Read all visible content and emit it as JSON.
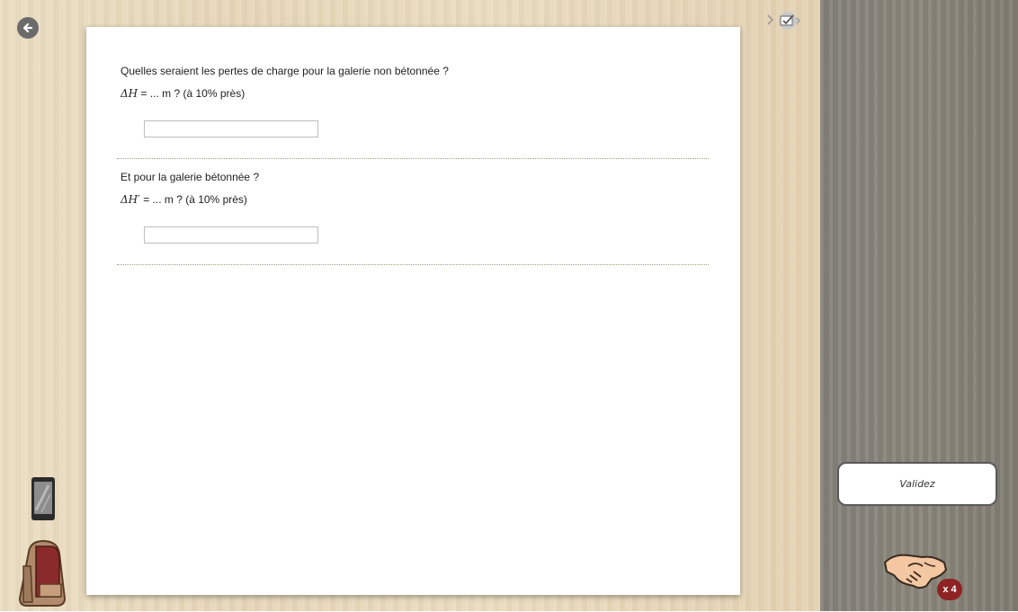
{
  "questions": [
    {
      "prompt": "Quelles seraient les pertes de charge pour la galerie non bétonnée ?",
      "symbol": "ΔH",
      "formula_rest": " = ... m ? (à 10% près)",
      "answer_value": ""
    },
    {
      "prompt": "Et pour la galerie bétonnée ?",
      "symbol": "ΔH′",
      "formula_rest": " = ... m ? (à 10% près)",
      "answer_value": ""
    }
  ],
  "sidebar": {
    "validate_label": "Validez",
    "help_count": "x 4"
  },
  "icons": {
    "back": "back-arrow-icon",
    "top": "notebook-check-icon",
    "phone": "smartphone-icon",
    "bag": "backpack-icon",
    "help": "handshake-icon"
  },
  "colors": {
    "badge": "#8f2323",
    "side_panel": "#86837a"
  }
}
